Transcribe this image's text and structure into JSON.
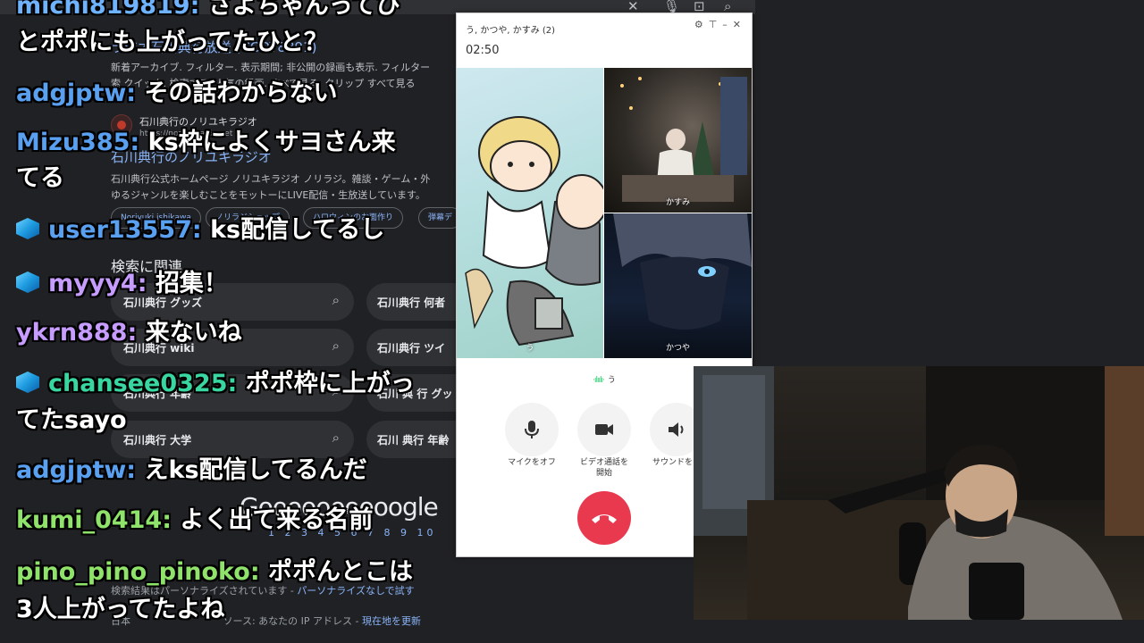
{
  "search": {
    "result_title": "ラジオ石川典行放送 (CCOY8891)",
    "sitelinks_line1": "新着アーカイブ. フィルター. 表示期間; 非公開の録画も表示. フィルター",
    "sitelinks_line2": "索 クイック. 検索する. 人気の録画. すべて見る. クリップ すべて見る",
    "site_name": "石川典行のノリユキラジオ",
    "site_url": "https://norimaradio.net",
    "site_heading": "石川典行のノリユキラジオ",
    "site_desc_line1": "石川典行公式ホームページ ノリユキラジオ ノリラジ。雑談・ゲーム・外",
    "site_desc_line2": "ゆるジャンルを楽しむことをモットーにLIVE配信・生放送しています。",
    "chips": [
      "Noriyuki ishikawa",
      "ノリラジショップ",
      "ハロウィンのお面作り",
      "弾幕デ"
    ],
    "related_heading": "検索に関連",
    "related": [
      "石川典行 グッズ",
      "石川典行 wiki",
      "石川典行 年齢",
      "石川典行 大学"
    ],
    "related_right": [
      "石川典行 何者",
      "石川典行 ツイ",
      "石川 典 行 グッ",
      "石川 典行 年齢"
    ],
    "logo": "Goooooooooogle",
    "pages": "1 2 3 4 5 6 7 8 9 10",
    "personalized": "検索結果はパーソナライズされています",
    "personalized_link": "パーソナライズなしで試す",
    "location_prefix": "日本",
    "location_text": "ソース: あなたの IP アドレス",
    "location_link": "現在地を更新"
  },
  "chat": [
    {
      "user": "michi819819:",
      "text": "さよちゃんってひ",
      "user_color": "#6fb3ff",
      "icon": false
    },
    {
      "user": "",
      "text": "とポポにも上がってたひと？",
      "user_color": "#ffffff",
      "icon": false
    },
    {
      "user": "adgjptw:",
      "text": "その話わからない",
      "user_color": "#5aa0f0",
      "icon": false
    },
    {
      "user": "Mizu385:",
      "text": "ks枠によくサヨさん来",
      "user_color": "#5aa0f0",
      "icon": false
    },
    {
      "user": "",
      "text": "てる",
      "user_color": "#ffffff",
      "icon": false
    },
    {
      "user": "user13557:",
      "text": "ks配信してるし",
      "user_color": "#5aa0f0",
      "icon": true
    },
    {
      "user": "myyy4:",
      "text": "招集！",
      "user_color": "#c79cff",
      "icon": true
    },
    {
      "user": "ykrn888:",
      "text": "来ないね",
      "user_color": "#c79cff",
      "icon": false
    },
    {
      "user": "chansee0325:",
      "text": "ポポ枠に上がっ",
      "user_color": "#38d6a0",
      "icon": true
    },
    {
      "user": "",
      "text": "てたsayo",
      "user_color": "#ffffff",
      "icon": false
    },
    {
      "user": "adgjptw:",
      "text": "えks配信してるんだ",
      "user_color": "#5aa0f0",
      "icon": false
    },
    {
      "user": "kumi_0414:",
      "text": "よく出て来る名前",
      "user_color": "#8fe36a",
      "icon": false
    },
    {
      "user": "pino_pino_pinoko:",
      "text": "ポポんとこは",
      "user_color": "#8fe36a",
      "icon": false
    },
    {
      "user": "",
      "text": "3人上がってたよね",
      "user_color": "#ffffff",
      "icon": false
    }
  ],
  "call": {
    "title": "う, かつや, かすみ (2)",
    "timer": "02:50",
    "participants": [
      "う",
      "かすみ",
      "かつや"
    ],
    "speaking_name": "う",
    "controls": [
      {
        "label_line1": "マイクをオフ",
        "label_line2": ""
      },
      {
        "label_line1": "ビデオ通話を",
        "label_line2": "開始"
      },
      {
        "label_line1": "サウンドをオ",
        "label_line2": ""
      }
    ]
  },
  "colors": {
    "bg": "#202124",
    "link": "#8ab4f8",
    "hangup": "#e9394f"
  }
}
